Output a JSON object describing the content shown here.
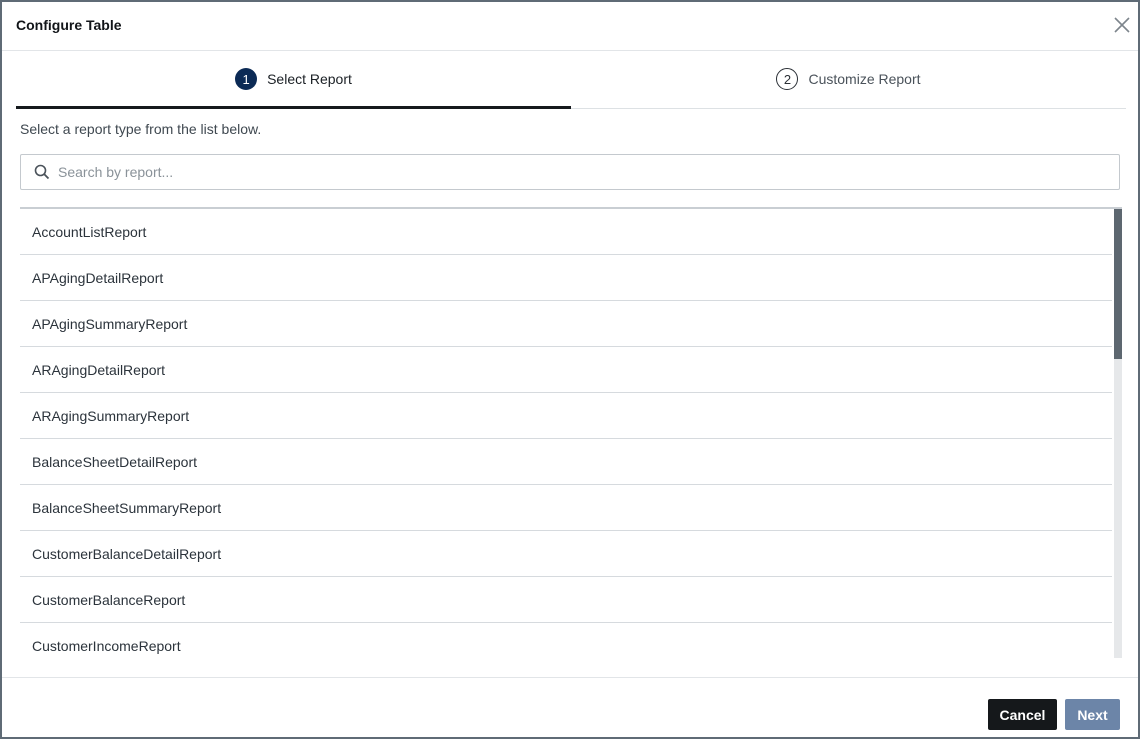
{
  "dialog": {
    "title": "Configure Table",
    "close_icon": "close-icon"
  },
  "steps": [
    {
      "number": "1",
      "label": "Select Report",
      "active": true
    },
    {
      "number": "2",
      "label": "Customize Report",
      "active": false
    }
  ],
  "instruction": "Select a report type from the list below.",
  "search": {
    "placeholder": "Search by report...",
    "value": "",
    "icon": "search-icon"
  },
  "reports": [
    "AccountListReport",
    "APAgingDetailReport",
    "APAgingSummaryReport",
    "ARAgingDetailReport",
    "ARAgingSummaryReport",
    "BalanceSheetDetailReport",
    "BalanceSheetSummaryReport",
    "CustomerBalanceDetailReport",
    "CustomerBalanceReport",
    "CustomerIncomeReport"
  ],
  "footer": {
    "cancel_label": "Cancel",
    "next_label": "Next"
  },
  "colors": {
    "step_active": "#0b2a55",
    "next_button": "#6c85a8",
    "cancel_button": "#15181b"
  }
}
